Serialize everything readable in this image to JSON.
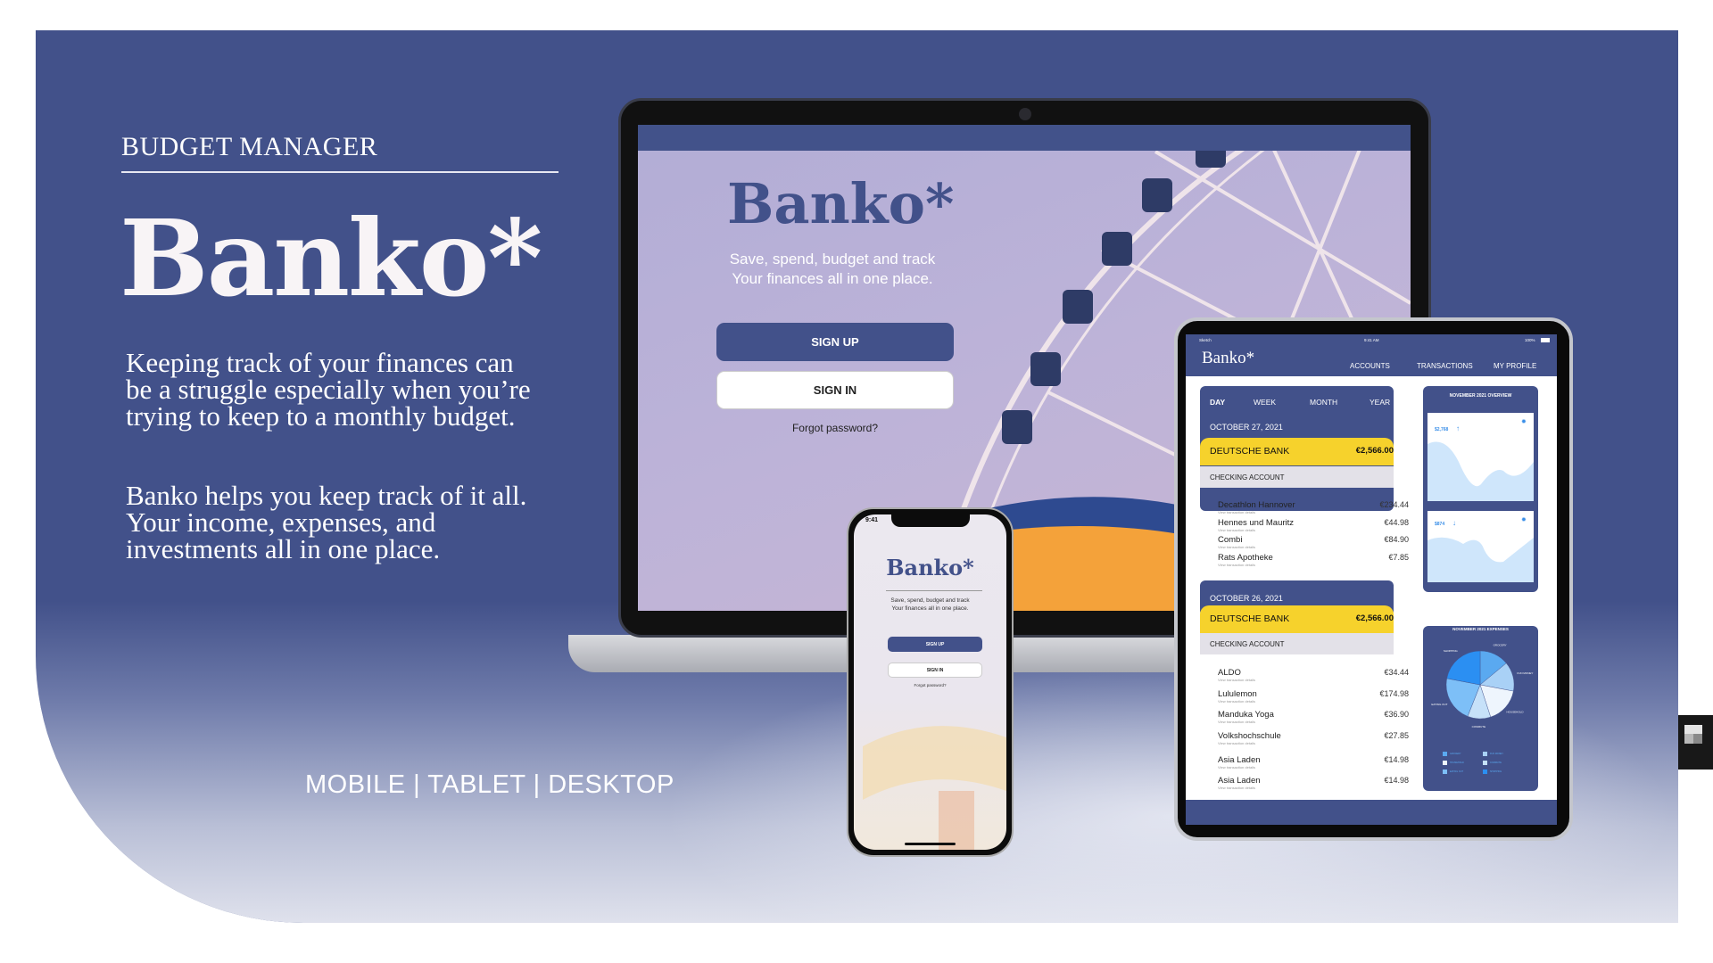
{
  "hero": {
    "kicker": "BUDGET MANAGER",
    "brand": "Banko*",
    "paragraph1": "Keeping track of your finances can be a struggle especially when you’re trying to keep to a monthly budget.",
    "paragraph2": "Banko helps you keep track of it all. Your income, expenses, and investments all in one place.",
    "platforms": "MOBILE | TABLET | DESKTOP"
  },
  "login": {
    "brand": "Banko*",
    "tagline1": "Save, spend, budget and track",
    "tagline2": "Your finances all in one place.",
    "sign_up": "SIGN UP",
    "sign_in": "SIGN IN",
    "forgot": "Forgot password?"
  },
  "phone": {
    "time": "9:41"
  },
  "tablet": {
    "status_carrier": "Sketch",
    "status_time": "9:41 AM",
    "status_battery": "100%",
    "brand": "Banko*",
    "nav": [
      "ACCOUNTS",
      "TRANSACTIONS",
      "MY PROFILE"
    ],
    "tabs": [
      "DAY",
      "WEEK",
      "MONTH",
      "YEAR"
    ],
    "sub_label": "View transaction details",
    "days": [
      {
        "date": "OCTOBER 27, 2021",
        "bank": "DEUTSCHE BANK",
        "balance": "€2,566.00",
        "account": "CHECKING ACCOUNT",
        "transactions": [
          {
            "name": "Decathlon Hannover",
            "amount": "€234.44"
          },
          {
            "name": "Hennes und Mauritz",
            "amount": "€44.98"
          },
          {
            "name": "Combi",
            "amount": "€84.90"
          },
          {
            "name": "Rats Apotheke",
            "amount": "€7.85"
          }
        ]
      },
      {
        "date": "OCTOBER 26, 2021",
        "bank": "DEUTSCHE BANK",
        "balance": "€2,566.00",
        "account": "CHECKING ACCOUNT",
        "transactions": [
          {
            "name": "ALDO",
            "amount": "€34.44"
          },
          {
            "name": "Lululemon",
            "amount": "€174.98"
          },
          {
            "name": "Manduka Yoga",
            "amount": "€36.90"
          },
          {
            "name": "Volkshochschule",
            "amount": "€27.85"
          },
          {
            "name": "Asia Laden",
            "amount": "€14.98"
          },
          {
            "name": "Asia Laden",
            "amount": "€14.98"
          }
        ]
      }
    ],
    "overview_title": "NOVEMBER 2021 OVERVIEW",
    "income_value": "$2,768",
    "spend_value": "$874",
    "expenses_title": "NOVEMBER 2021 EXPENSES"
  },
  "colors": {
    "brand": "#42518a",
    "highlight": "#f6d22c"
  },
  "chart_data": {
    "type": "pie",
    "title": "NOVEMBER 2021 EXPENSES",
    "categories": [
      "GROCERY",
      "FUN MONEY",
      "HOUSEHOLD",
      "COMMUTE",
      "EATING OUT",
      "SHOPPING"
    ],
    "values": [
      14,
      14,
      17,
      11,
      22,
      22
    ],
    "colors": [
      "#5aa9f0",
      "#a9d1f6",
      "#eef5fd",
      "#c6e1f9",
      "#7dbff7",
      "#2b8ff2"
    ]
  }
}
